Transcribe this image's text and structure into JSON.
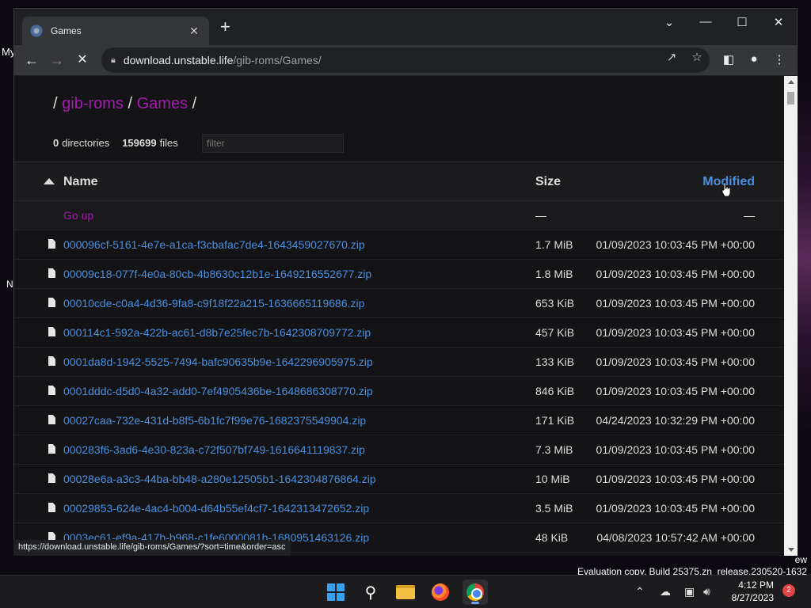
{
  "desktop": {
    "left_labels": [
      "My",
      "N"
    ],
    "eval_line1": "ew",
    "eval_line2": "Evaluation copy. Build 25375.zn_release.230520-1632"
  },
  "browser": {
    "tab_title": "Games",
    "tab_close": "✕",
    "new_tab": "+",
    "url_host": "download.unstable.life",
    "url_path": "/gib-roms/Games/",
    "status_url": "https://download.unstable.life/gib-roms/Games/?sort=time&order=asc"
  },
  "page": {
    "breadcrumb": {
      "sep": "/",
      "parts": [
        "gib-roms",
        "Games"
      ]
    },
    "summary": {
      "dirs_count": "0",
      "dirs_label": "directories",
      "files_count": "159699",
      "files_label": "files"
    },
    "filter_placeholder": "filter",
    "headers": {
      "name": "Name",
      "size": "Size",
      "modified": "Modified"
    },
    "go_up": {
      "label": "Go up",
      "size": "—",
      "modified": "—"
    },
    "files": [
      {
        "name": "000096cf-5161-4e7e-a1ca-f3cbafac7de4-1643459027670.zip",
        "size": "1.7 MiB",
        "modified": "01/09/2023 10:03:45 PM +00:00"
      },
      {
        "name": "00009c18-077f-4e0a-80cb-4b8630c12b1e-1649216552677.zip",
        "size": "1.8 MiB",
        "modified": "01/09/2023 10:03:45 PM +00:00"
      },
      {
        "name": "00010cde-c0a4-4d36-9fa8-c9f18f22a215-1636665119686.zip",
        "size": "653 KiB",
        "modified": "01/09/2023 10:03:45 PM +00:00"
      },
      {
        "name": "000114c1-592a-422b-ac61-d8b7e25fec7b-1642308709772.zip",
        "size": "457 KiB",
        "modified": "01/09/2023 10:03:45 PM +00:00"
      },
      {
        "name": "0001da8d-1942-5525-7494-bafc90635b9e-1642296905975.zip",
        "size": "133 KiB",
        "modified": "01/09/2023 10:03:45 PM +00:00"
      },
      {
        "name": "0001dddc-d5d0-4a32-add0-7ef4905436be-1648686308770.zip",
        "size": "846 KiB",
        "modified": "01/09/2023 10:03:45 PM +00:00"
      },
      {
        "name": "00027caa-732e-431d-b8f5-6b1fc7f99e76-1682375549904.zip",
        "size": "171 KiB",
        "modified": "04/24/2023 10:32:29 PM +00:00"
      },
      {
        "name": "000283f6-3ad6-4e30-823a-c72f507bf749-1616641119837.zip",
        "size": "7.3 MiB",
        "modified": "01/09/2023 10:03:45 PM +00:00"
      },
      {
        "name": "00028e6a-a3c3-44ba-bb48-a280e12505b1-1642304876864.zip",
        "size": "10 MiB",
        "modified": "01/09/2023 10:03:45 PM +00:00"
      },
      {
        "name": "00029853-624e-4ac4-b004-d64b55ef4cf7-1642313472652.zip",
        "size": "3.5 MiB",
        "modified": "01/09/2023 10:03:45 PM +00:00"
      },
      {
        "name": "0003ec61-ef9a-417b-b968-c1fe6000081b-1680951463126.zip",
        "size": "48 KiB",
        "modified": "04/08/2023 10:57:42 AM +00:00"
      }
    ]
  },
  "taskbar": {
    "time": "4:12 PM",
    "date": "8/27/2023",
    "notification_count": "2"
  },
  "colors": {
    "link": "#4a8fe0",
    "visited": "#a61bb0",
    "page_bg": "#141416",
    "chrome_bg": "#202124"
  }
}
